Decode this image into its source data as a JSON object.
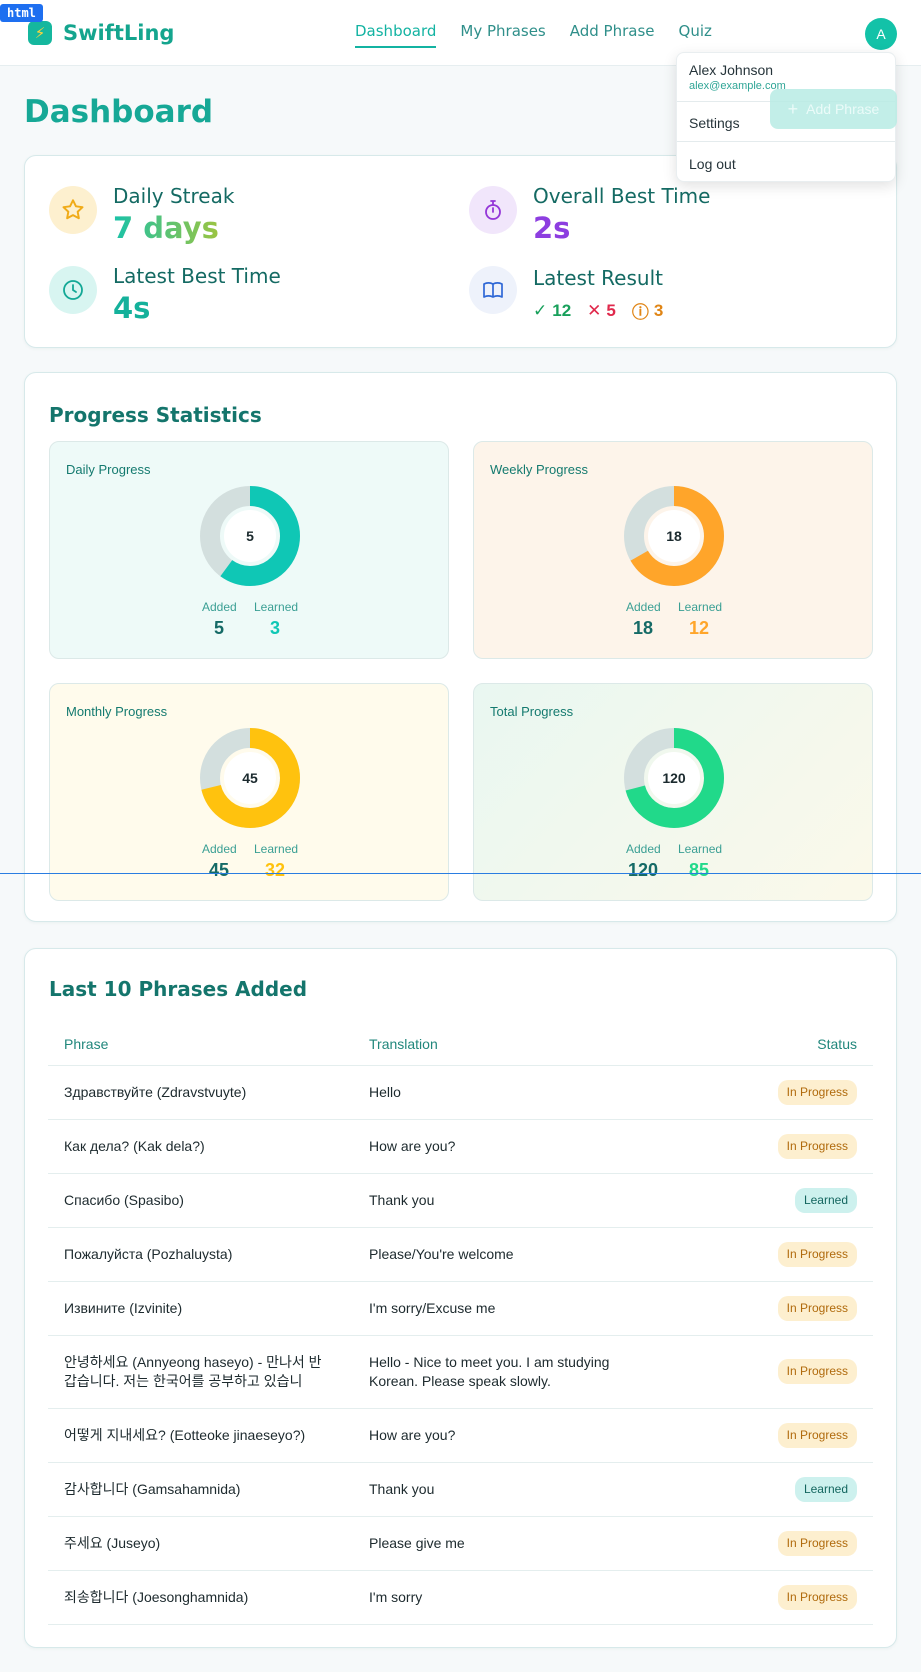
{
  "app": {
    "badge": "html",
    "name": "SwiftLing",
    "logo_icon": "bolt-icon"
  },
  "nav": {
    "items": [
      {
        "label": "Dashboard",
        "active": true
      },
      {
        "label": "My Phrases",
        "active": false
      },
      {
        "label": "Add Phrase",
        "active": false
      },
      {
        "label": "Quiz",
        "active": false
      }
    ]
  },
  "user": {
    "initial": "A",
    "name": "Alex Johnson",
    "email": "alex@example.com",
    "menu": {
      "settings": "Settings",
      "logout": "Log out"
    }
  },
  "page": {
    "title": "Dashboard",
    "add_phrase_button": "Add Phrase"
  },
  "stats": {
    "daily_streak": {
      "label": "Daily Streak",
      "value": "7 days",
      "icon": "star-icon"
    },
    "overall_best_time": {
      "label": "Overall Best Time",
      "value": "2s",
      "icon": "stopwatch-icon"
    },
    "latest_best_time": {
      "label": "Latest Best Time",
      "value": "4s",
      "icon": "clock-icon"
    },
    "latest_result": {
      "label": "Latest Result",
      "correct": "12",
      "wrong": "5",
      "skipped": "3",
      "icon": "book-icon"
    }
  },
  "progress": {
    "title": "Progress Statistics",
    "added_label": "Added",
    "learned_label": "Learned",
    "cards": [
      {
        "title": "Daily Progress",
        "center": "5",
        "added": "5",
        "learned": "3",
        "added_n": 5,
        "learned_n": 3,
        "color": "#0fc7b5",
        "bg": "#eefaf8"
      },
      {
        "title": "Weekly Progress",
        "center": "18",
        "added": "18",
        "learned": "12",
        "added_n": 18,
        "learned_n": 12,
        "color": "#ffa52a",
        "bg": "#fdf4ea"
      },
      {
        "title": "Monthly Progress",
        "center": "45",
        "added": "45",
        "learned": "32",
        "added_n": 45,
        "learned_n": 32,
        "color": "#ffc20e",
        "bg": "#fffbec"
      },
      {
        "title": "Total Progress",
        "center": "120",
        "added": "120",
        "learned": "85",
        "added_n": 120,
        "learned_n": 85,
        "color": "#21d98a",
        "bg": "#edf7ef"
      }
    ]
  },
  "phrases": {
    "title": "Last 10 Phrases Added",
    "headers": {
      "phrase": "Phrase",
      "translation": "Translation",
      "status": "Status"
    },
    "rows": [
      {
        "phrase": "Здравствуйте (Zdravstvuyte)",
        "translation": "Hello",
        "status": "In Progress"
      },
      {
        "phrase": "Как дела? (Kak dela?)",
        "translation": "How are you?",
        "status": "In Progress"
      },
      {
        "phrase": "Спасибо (Spasibo)",
        "translation": "Thank you",
        "status": "Learned"
      },
      {
        "phrase": "Пожалуйста (Pozhaluysta)",
        "translation": "Please/You're welcome",
        "status": "In Progress"
      },
      {
        "phrase": "Извините (Izvinite)",
        "translation": "I'm sorry/Excuse me",
        "status": "In Progress"
      },
      {
        "phrase": "안녕하세요 (Annyeong haseyo) - 만나서 반갑습니다. 저는 한국어를 공부하고 있습니",
        "translation": "Hello - Nice to meet you. I am studying Korean. Please speak slowly.",
        "status": "In Progress"
      },
      {
        "phrase": "어떻게 지내세요? (Eotteoke jinaeseyo?)",
        "translation": "How are you?",
        "status": "In Progress"
      },
      {
        "phrase": "감사합니다 (Gamsahamnida)",
        "translation": "Thank you",
        "status": "Learned"
      },
      {
        "phrase": "주세요 (Juseyo)",
        "translation": "Please give me",
        "status": "In Progress"
      },
      {
        "phrase": "죄송합니다 (Joesonghamnida)",
        "translation": "I'm sorry",
        "status": "In Progress"
      }
    ]
  }
}
